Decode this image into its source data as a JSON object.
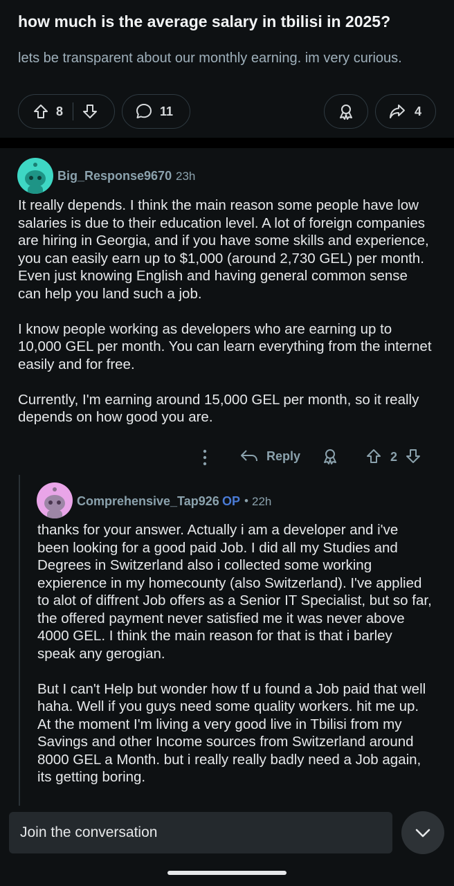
{
  "post": {
    "title": "how much is the average salary in tbilisi in 2025?",
    "body": "lets be transparent about our monthly earning. im very curious.",
    "upvotes": "8",
    "comments": "11",
    "shares": "4"
  },
  "comment1": {
    "username": "Big_Response9670",
    "time": "23h",
    "paragraphs": [
      "It really depends. I think the main reason some people have low salaries is due to their education level. A lot of foreign companies are hiring in Georgia, and if you have some skills and experience, you can easily earn up to $1,000 (around 2,730 GEL) per month. Even just knowing English and having general common sense can help you land such a job.",
      "I know people working as developers who are earning up to 10,000 GEL per month. You can learn everything from the internet easily and for free.",
      "Currently, I'm earning around 15,000 GEL per month, so it really depends on how good you are."
    ],
    "reply_label": "Reply",
    "votes": "2",
    "avatar_color": "#3ed7c4"
  },
  "comment2": {
    "username": "Comprehensive_Tap926",
    "op_badge": "OP",
    "separator": "•",
    "time": "22h",
    "paragraphs": [
      "thanks for your answer. Actually i am a developer and i've been looking for a good paid Job. I did all my Studies and Degrees in Switzerland also i collected some working expierence in my homecounty (also Switzerland). I've applied to alot of diffrent Job offers as a Senior IT Specialist, but so far, the offered payment never satisfied me it was never above 4000 GEL. I think the main reason for that is that i barley speak any gerogian.",
      "But I can't Help but wonder how tf u found a Job paid that well haha. Well if you guys need some quality workers. hit me up. At the moment I'm living a very good live in Tbilisi from my Savings and other Income sources from Switzerland around 8000 GEL a Month. but i really really badly need a Job again, its getting boring."
    ],
    "avatar_color": "#e9a5e8"
  },
  "composer": {
    "placeholder": "Join the conversation"
  },
  "colors": {
    "background": "#0e1113",
    "op_blue": "#4a7bd6",
    "meta_gray": "#8ba2ad"
  }
}
